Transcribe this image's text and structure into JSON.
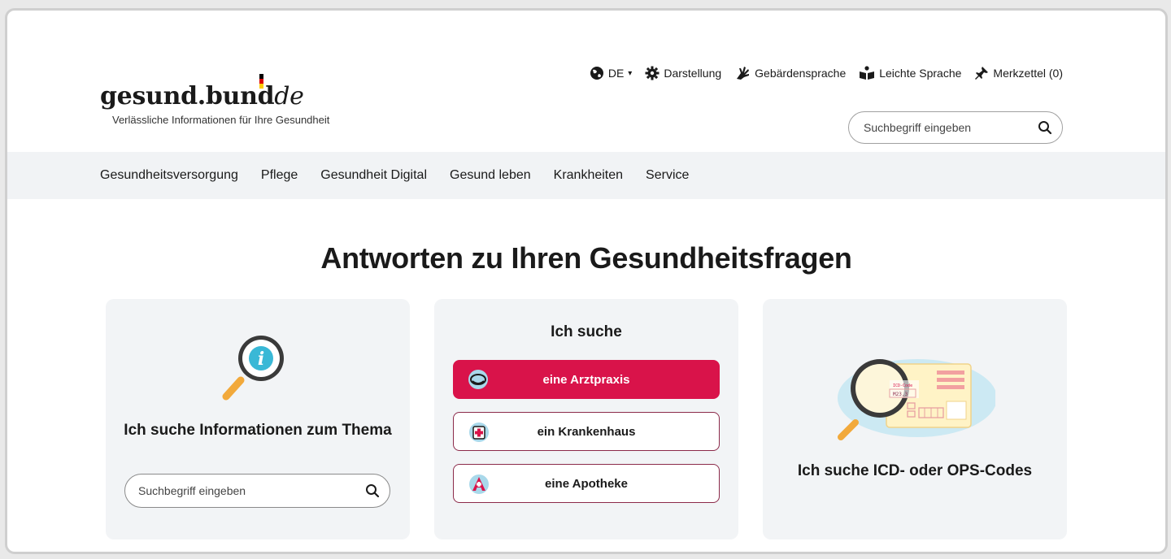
{
  "logo": {
    "name_main": "gesund.bund",
    "name_suffix": "de",
    "tagline": "Verlässliche Informationen für Ihre Gesundheit"
  },
  "util_nav": {
    "language": "DE",
    "display": "Darstellung",
    "sign_language": "Gebärdensprache",
    "easy_language": "Leichte Sprache",
    "bookmark": "Merkzettel (0)"
  },
  "header_search": {
    "placeholder": "Suchbegriff eingeben"
  },
  "main_nav": {
    "items": [
      {
        "label": "Gesundheitsversorgung"
      },
      {
        "label": "Pflege"
      },
      {
        "label": "Gesundheit Digital"
      },
      {
        "label": "Gesund leben"
      },
      {
        "label": "Krankheiten"
      },
      {
        "label": "Service"
      }
    ]
  },
  "headline": "Antworten zu Ihren Gesundheitsfragen",
  "cards": {
    "info": {
      "title": "Ich suche Informationen zum Thema",
      "search_placeholder": "Suchbegriff eingeben"
    },
    "find": {
      "title": "Ich suche",
      "options": [
        {
          "label": "eine Arztpraxis",
          "icon": "doctor-icon"
        },
        {
          "label": "ein Krankenhaus",
          "icon": "hospital-icon"
        },
        {
          "label": "eine Apotheke",
          "icon": "pharmacy-icon"
        }
      ]
    },
    "icd": {
      "title": "Ich suche ICD- oder OPS-Codes",
      "art_label": "ICD-Code",
      "art_code": "M23.3"
    }
  },
  "colors": {
    "accent": "#d9134a",
    "outline": "#8c2a4a",
    "nav_bg": "#f1f3f5",
    "card_bg": "#f2f4f6"
  }
}
